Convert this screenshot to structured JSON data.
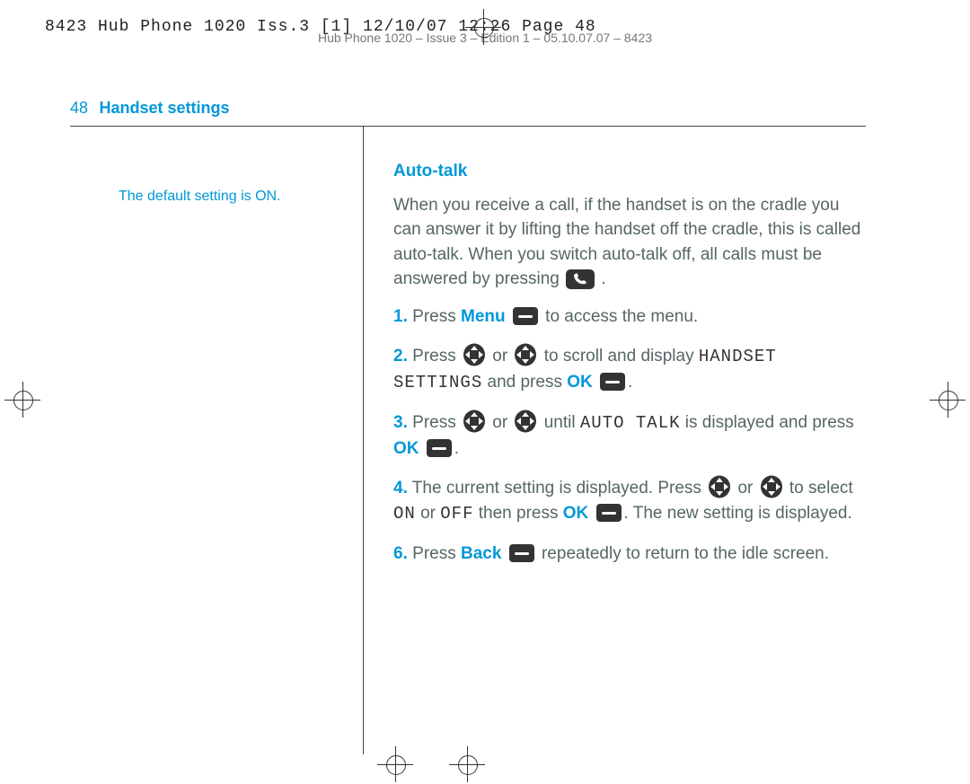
{
  "doc": {
    "slug": "8423 Hub Phone 1020 Iss.3 [1]  12/10/07  12:26  Page 48",
    "subslug": "Hub Phone 1020 – Issue 3 – Edition 1 – 05.10.07.07 – 8423",
    "page_number": "48",
    "section_title": "Handset settings"
  },
  "side": {
    "note": "The default setting is ON."
  },
  "body": {
    "heading": "Auto-talk",
    "intro_a": "When you receive a call, if the handset is on the cradle you can answer it by lifting the handset off the cradle, this is called auto-talk. When you switch auto-talk off, all calls must be answered by pressing ",
    "intro_b": ".",
    "steps": {
      "s1": {
        "n": "1.",
        "a": "Press ",
        "kw": "Menu",
        "b": " to access the menu."
      },
      "s2": {
        "n": "2.",
        "a": "Press ",
        "b": " or ",
        "c": " to scroll and display ",
        "mono": "HANDSET SETTINGS",
        "d": " and press ",
        "kw": "OK",
        "e": "."
      },
      "s3": {
        "n": "3.",
        "a": "Press ",
        "b": " or ",
        "c": " until ",
        "mono": "AUTO TALK",
        "d": " is displayed and press ",
        "kw": "OK",
        "e": "."
      },
      "s4": {
        "n": "4.",
        "a": "The current setting is displayed. Press ",
        "b": " or ",
        "c": " to select ",
        "mono_on": "ON",
        "d": " or ",
        "mono_off": "OFF",
        "e": " then press ",
        "kw": "OK",
        "f": ". The new setting is displayed."
      },
      "s6": {
        "n": "6.",
        "a": "Press ",
        "kw": "Back",
        "b": " repeatedly to return to the idle screen."
      }
    }
  }
}
